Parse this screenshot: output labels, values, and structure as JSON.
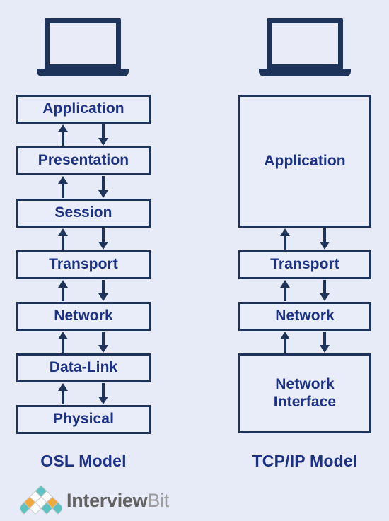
{
  "background_color": "#e7ebf7",
  "ink_color": "#1e3359",
  "text_color": "#1c3184",
  "box_fill_color": "#e9edf9",
  "diagram": {
    "title_left": "OSL Model",
    "title_right": "TCP/IP Model",
    "device_icon_left": "laptop-icon",
    "device_icon_right": "laptop-icon",
    "osi": {
      "caption": "OSL Model",
      "layers": [
        {
          "label": "Application",
          "index": 7
        },
        {
          "label": "Presentation",
          "index": 6
        },
        {
          "label": "Session",
          "index": 5
        },
        {
          "label": "Transport",
          "index": 4
        },
        {
          "label": "Network",
          "index": 3
        },
        {
          "label": "Data-Link",
          "index": 2
        },
        {
          "label": "Physical",
          "index": 1
        }
      ]
    },
    "tcpip": {
      "caption": "TCP/IP Model",
      "layers": [
        {
          "label": "Application",
          "index": 4
        },
        {
          "label": "Transport",
          "index": 3
        },
        {
          "label": "Network",
          "index": 2
        },
        {
          "label": "Network\nInterface",
          "index": 1
        }
      ]
    },
    "arrow_directions": [
      "up",
      "down"
    ]
  },
  "brand": {
    "name_primary": "Interview",
    "name_secondary": "Bit",
    "logo_colors": {
      "teal": "#5fc2c2",
      "orange": "#f2a93b",
      "white": "#ffffff",
      "outline": "#c9c9c9"
    }
  }
}
